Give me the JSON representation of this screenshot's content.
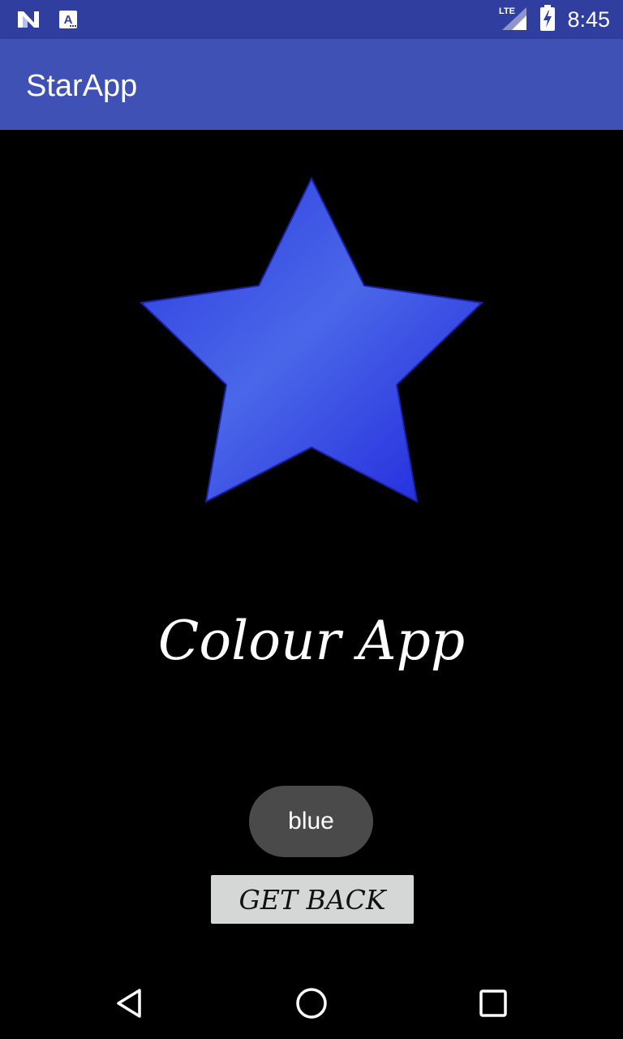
{
  "status_bar": {
    "time": "8:45",
    "network": "LTE",
    "icons": [
      "n-logo-icon",
      "a-notification-icon",
      "lte-signal-icon",
      "battery-charging-icon"
    ]
  },
  "app_bar": {
    "title": "StarApp"
  },
  "main": {
    "star_icon": "star-icon",
    "headline": "Colour App",
    "colour_button_label": "blue",
    "back_button_label": "GET BACK"
  },
  "nav_bar": {
    "icons": [
      "back-icon",
      "home-icon",
      "recents-icon"
    ]
  },
  "colors": {
    "status_bar": "#303F9F",
    "app_bar": "#3F51B5",
    "background": "#000000",
    "star_blue": "#2B35E0"
  }
}
